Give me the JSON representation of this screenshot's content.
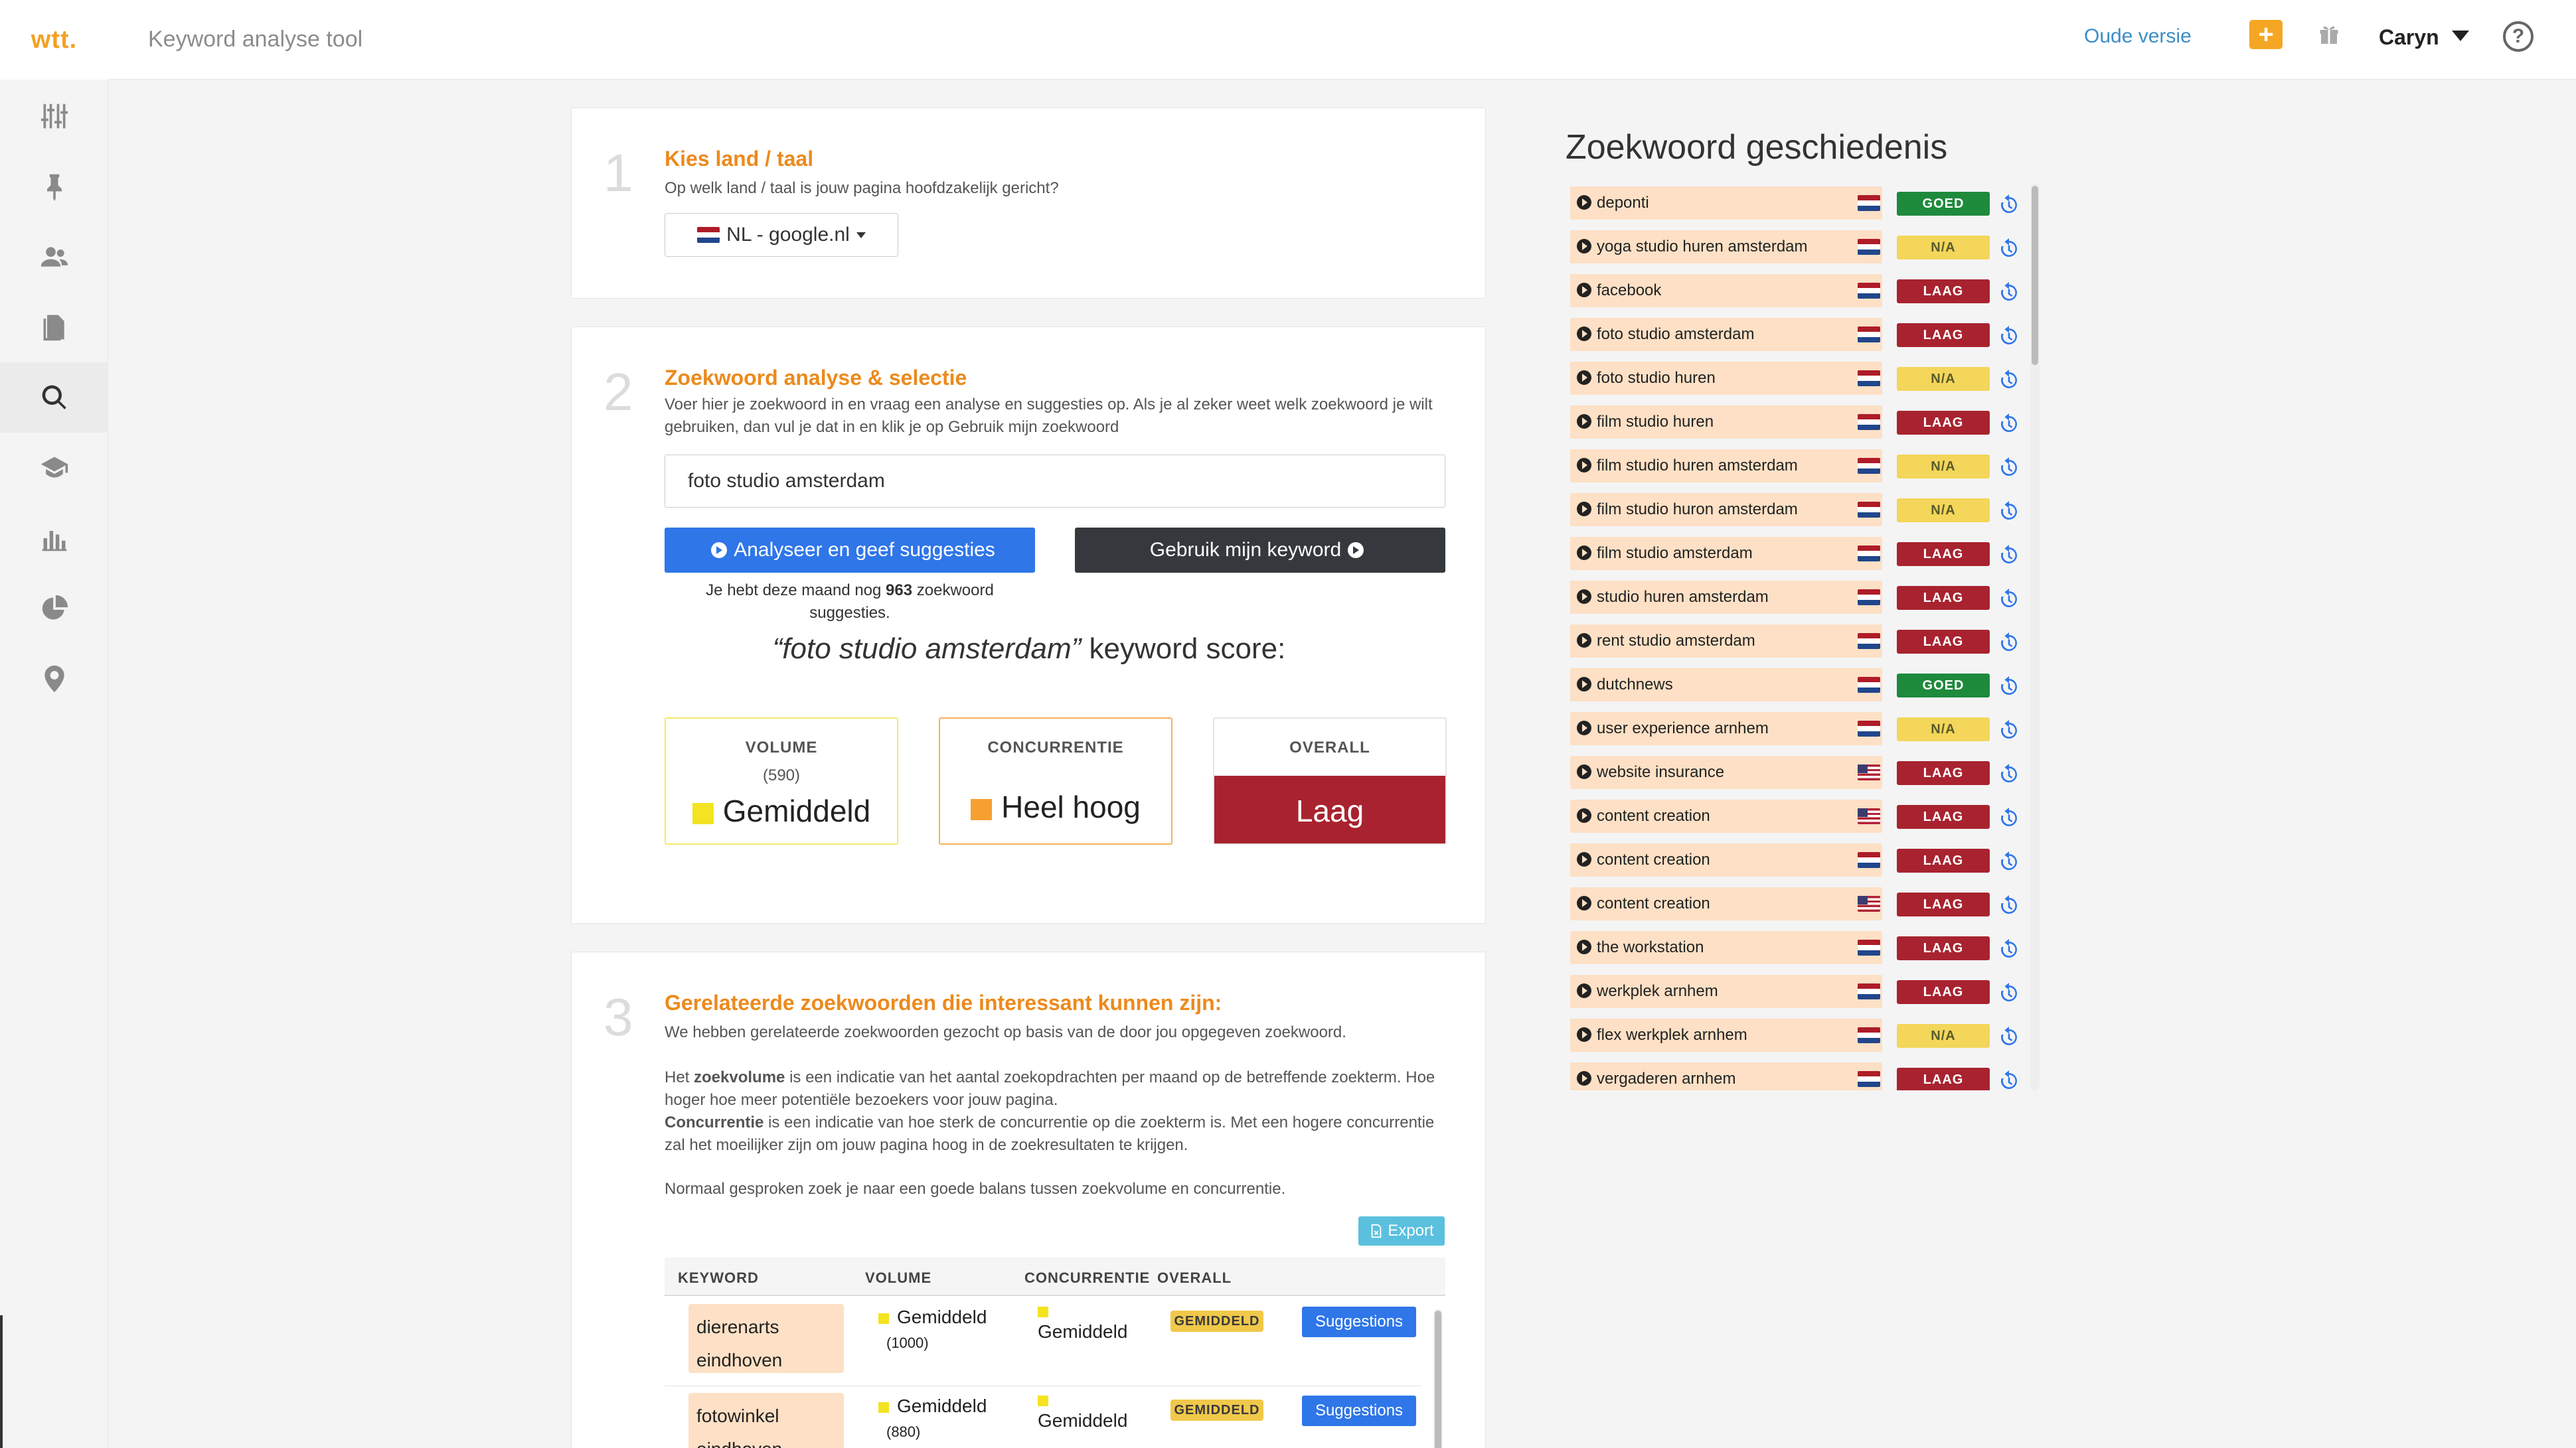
{
  "app": {
    "logo": "wtt.",
    "tool_title": "Keyword analyse tool",
    "old_version": "Oude versie",
    "plus_label": "+",
    "user_name": "Caryn",
    "help_label": "?"
  },
  "sidebar": {
    "icons": [
      "sliders-icon",
      "pin-icon",
      "users-icon",
      "document-icon",
      "search-icon",
      "graduation-cap-icon",
      "bar-chart-icon",
      "pie-chart-icon",
      "map-marker-icon"
    ]
  },
  "step1": {
    "num": "1",
    "title": "Kies land / taal",
    "subtitle": "Op welk land / taal is jouw pagina hoofdzakelijk gericht?",
    "country": "NL - google.nl"
  },
  "step2": {
    "num": "2",
    "title": "Zoekwoord analyse & selectie",
    "subtitle": "Voer hier je zoekwoord in en vraag een analyse en suggesties op. Als je al zeker weet welk zoekwoord je wilt gebruiken, dan vul je dat in en klik je op Gebruik mijn zoekwoord",
    "keyword": "foto studio amsterdam",
    "analyse_label": "Analyseer en geef suggesties",
    "use_label": "Gebruik mijn keyword",
    "quota_pre": "Je hebt deze maand nog ",
    "quota_count": "963",
    "quota_post": " zoekwoord suggesties.",
    "score_keyword": "“foto studio amsterdam”",
    "score_suffix": " keyword score:",
    "volume": {
      "label": "VOLUME",
      "count": "(590)",
      "value": "Gemiddeld",
      "color": "#f4e320"
    },
    "concurrentie": {
      "label": "CONCURRENTIE",
      "value": "Heel hoog",
      "color": "#f5a030"
    },
    "overall": {
      "label": "OVERALL",
      "value": "Laag",
      "color": "#a8232f"
    }
  },
  "step3": {
    "num": "3",
    "title": "Gerelateerde zoekwoorden die interessant kunnen zijn:",
    "intro": "We hebben gerelateerde zoekwoorden gezocht op basis van de door jou opgegeven zoekwoord.",
    "p1_pre": "Het ",
    "p1_bold": "zoekvolume",
    "p1_post": " is een indicatie van het aantal zoekopdrachten per maand op de betreffende zoekterm. Hoe hoger hoe meer potentiële bezoekers voor jouw pagina.",
    "p2_bold": "Concurrentie",
    "p2_post": " is een indicatie van hoe sterk de concurrentie op die zoekterm is. Met een hogere concurrentie zal het moeilijker zijn om jouw pagina hoog in de zoekresultaten te krijgen.",
    "p3": "Normaal gesproken zoek je naar een goede balans tussen zoekvolume en concurrentie.",
    "export_label": "Export",
    "columns": [
      "KEYWORD",
      "VOLUME",
      "CONCURRENTIE",
      "OVERALL"
    ],
    "rows": [
      {
        "keyword": "dierenarts eindhoven",
        "volume": "Gemiddeld",
        "volume_count": "(1000)",
        "concurrentie": "Gemiddeld",
        "overall": "GEMIDDELD",
        "action": "Suggestions"
      },
      {
        "keyword": "fotowinkel eindhoven",
        "volume": "Gemiddeld",
        "volume_count": "(880)",
        "concurrentie": "Gemiddeld",
        "overall": "GEMIDDELD",
        "action": "Suggestions"
      }
    ]
  },
  "history": {
    "title": "Zoekwoord geschiedenis",
    "items": [
      {
        "keyword": "deponti",
        "flag": "nl",
        "status": "GOED"
      },
      {
        "keyword": "yoga studio huren amsterdam",
        "flag": "nl",
        "status": "N/A"
      },
      {
        "keyword": "facebook",
        "flag": "nl",
        "status": "LAAG"
      },
      {
        "keyword": "foto studio amsterdam",
        "flag": "nl",
        "status": "LAAG"
      },
      {
        "keyword": "foto studio huren",
        "flag": "nl",
        "status": "N/A"
      },
      {
        "keyword": "film studio huren",
        "flag": "nl",
        "status": "LAAG"
      },
      {
        "keyword": "film studio huren amsterdam",
        "flag": "nl",
        "status": "N/A"
      },
      {
        "keyword": "film studio huron amsterdam",
        "flag": "nl",
        "status": "N/A"
      },
      {
        "keyword": "film studio amsterdam",
        "flag": "nl",
        "status": "LAAG"
      },
      {
        "keyword": "studio huren amsterdam",
        "flag": "nl",
        "status": "LAAG"
      },
      {
        "keyword": "rent studio amsterdam",
        "flag": "nl",
        "status": "LAAG"
      },
      {
        "keyword": "dutchnews",
        "flag": "nl",
        "status": "GOED"
      },
      {
        "keyword": "user experience arnhem",
        "flag": "nl",
        "status": "N/A"
      },
      {
        "keyword": "website insurance",
        "flag": "us",
        "status": "LAAG"
      },
      {
        "keyword": "content creation",
        "flag": "us",
        "status": "LAAG"
      },
      {
        "keyword": "content creation",
        "flag": "nl",
        "status": "LAAG"
      },
      {
        "keyword": "content creation",
        "flag": "us",
        "status": "LAAG"
      },
      {
        "keyword": "the workstation",
        "flag": "nl",
        "status": "LAAG"
      },
      {
        "keyword": "werkplek arnhem",
        "flag": "nl",
        "status": "LAAG"
      },
      {
        "keyword": "flex werkplek arnhem",
        "flag": "nl",
        "status": "N/A"
      },
      {
        "keyword": "vergaderen arnhem",
        "flag": "nl",
        "status": "LAAG"
      }
    ]
  }
}
